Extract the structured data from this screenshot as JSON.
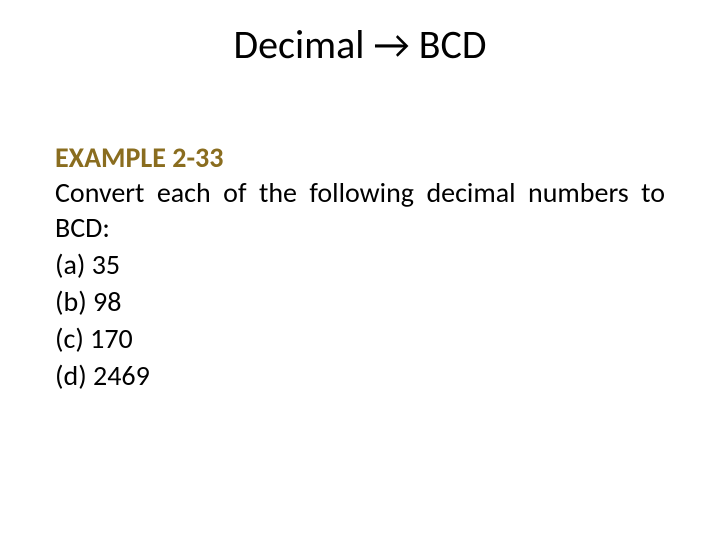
{
  "title": "Decimal → BCD",
  "example_label": "EXAMPLE 2-33",
  "prompt": "Convert each of the following decimal numbers to BCD:",
  "items": {
    "a": "(a) 35",
    "b": "(b) 98",
    "c": "(c) 170",
    "d": "(d) 2469"
  }
}
